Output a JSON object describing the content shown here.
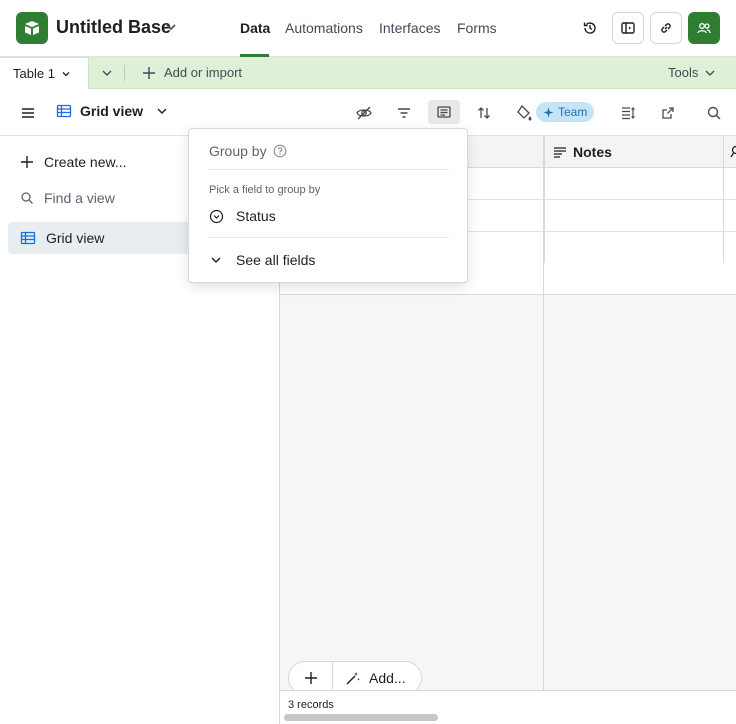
{
  "app": {
    "base_title": "Untitled Base",
    "nav_tabs": [
      "Data",
      "Automations",
      "Interfaces",
      "Forms"
    ],
    "active_tab": "Data",
    "brand_color": "#2e7d32"
  },
  "tablebar": {
    "table_name": "Table 1",
    "add_import_label": "Add or import",
    "tools_label": "Tools"
  },
  "viewbar": {
    "view_name": "Grid view",
    "team_badge": "Team"
  },
  "sidebar": {
    "create_label": "Create new...",
    "find_placeholder": "Find a view",
    "active_view": "Grid view"
  },
  "grid": {
    "notes_header": "Notes",
    "add_label": "Add...",
    "records_count": "3 records"
  },
  "popover": {
    "title": "Group by",
    "hint": "Pick a field to group by",
    "field": "Status",
    "see_all": "See all fields"
  }
}
